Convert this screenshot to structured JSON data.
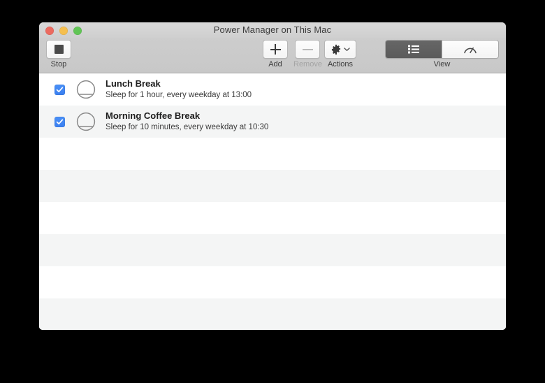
{
  "window": {
    "title": "Power Manager on This Mac",
    "traffic_lights": [
      {
        "name": "close",
        "color": "#ec6a5f"
      },
      {
        "name": "minimize",
        "color": "#f5bf4f"
      },
      {
        "name": "zoom",
        "color": "#61c555"
      }
    ]
  },
  "toolbar": {
    "stop": {
      "label": "Stop",
      "icon": "stop-square-icon",
      "enabled": true
    },
    "add": {
      "label": "Add",
      "icon": "plus-icon",
      "enabled": true
    },
    "remove": {
      "label": "Remove",
      "icon": "minus-icon",
      "enabled": false
    },
    "actions": {
      "label": "Actions",
      "icon": "gear-icon",
      "enabled": true
    },
    "view": {
      "label": "View",
      "segments": [
        {
          "name": "list-view",
          "icon": "list-icon",
          "selected": true
        },
        {
          "name": "gauge-view",
          "icon": "gauge-icon",
          "selected": false
        }
      ]
    }
  },
  "list": {
    "rows": [
      {
        "checked": true,
        "icon": "sleep-icon",
        "title": "Lunch Break",
        "subtitle": "Sleep for 1 hour, every weekday at 13:00"
      },
      {
        "checked": true,
        "icon": "sleep-icon",
        "title": "Morning Coffee Break",
        "subtitle": "Sleep for 10 minutes, every weekday at 10:30"
      }
    ],
    "empty_row_count": 6
  },
  "colors": {
    "accent_blue": "#3a7ff0",
    "toolbar_grey": "#cdcdcd",
    "alt_row_grey": "#f4f5f5",
    "selected_segment": "#5f5f5f"
  }
}
